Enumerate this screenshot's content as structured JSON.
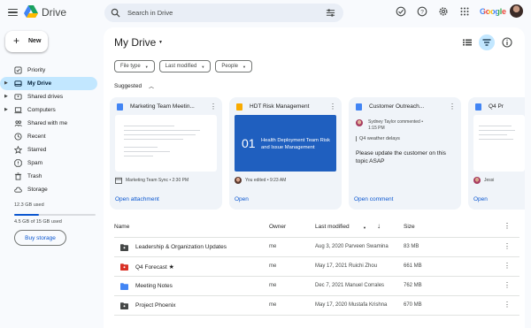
{
  "app": {
    "title": "Drive"
  },
  "search": {
    "placeholder": "Search in Drive"
  },
  "header": {
    "brand": "Google"
  },
  "sidebar": {
    "new_label": "New",
    "items": [
      {
        "label": "Priority",
        "icon": "priority-icon"
      },
      {
        "label": "My Drive",
        "icon": "my-drive-icon",
        "active": true
      },
      {
        "label": "Shared drives",
        "icon": "shared-drives-icon"
      },
      {
        "label": "Computers",
        "icon": "computer-icon"
      },
      {
        "label": "Shared with me",
        "icon": "shared-with-me-icon"
      },
      {
        "label": "Recent",
        "icon": "clock-icon"
      },
      {
        "label": "Starred",
        "icon": "star-icon"
      },
      {
        "label": "Spam",
        "icon": "spam-icon"
      },
      {
        "label": "Trash",
        "icon": "trash-icon"
      },
      {
        "label": "Storage",
        "icon": "cloud-icon"
      }
    ],
    "storage_used": "12.3 GB used",
    "storage_detail": "4.5 GB of 15 GB used",
    "storage_fraction": 0.3,
    "buy_storage": "Buy storage"
  },
  "main": {
    "title": "My Drive",
    "filters": [
      "File type",
      "Last modified",
      "People"
    ],
    "suggested_label": "Suggested"
  },
  "cards": [
    {
      "title": "Marketing Team Meetin...",
      "meta": "Marketing Team Sync • 2:30 PM",
      "action": "Open attachment",
      "icon_color": "#4285f4"
    },
    {
      "title": "HDT Risk Management",
      "slide_num": "01",
      "slide_text": "Health Deployment Team Risk and Issue Management",
      "meta": "You edited • 9:23 AM",
      "action": "Open",
      "icon_color": "#f9ab00"
    },
    {
      "title": "Customer Outreach...",
      "commenter": "Sydney Taylor commented •",
      "comment_time": "1:15 PM",
      "quote": "Q4 weather delays",
      "comment": "Please update the customer on this topic ASAP",
      "action": "Open comment",
      "icon_color": "#4285f4"
    },
    {
      "title": "Q4 Pr",
      "meta": "Jessi",
      "action": "Open",
      "icon_color": "#4285f4"
    }
  ],
  "table": {
    "headers": {
      "name": "Name",
      "owner": "Owner",
      "modified": "Last modified",
      "size": "Size"
    },
    "rows": [
      {
        "name": "Leadership & Organization Updates",
        "owner": "me",
        "modified": "Aug 3, 2020 Parveen Swamina",
        "size": "83 MB",
        "type": "shared-folder"
      },
      {
        "name": "Q4 Forecast",
        "owner": "me",
        "modified": "May 17, 2021 Ruichi Zhou",
        "size": "661 MB",
        "type": "red-shared-folder",
        "starred": true
      },
      {
        "name": "Meeting Notes",
        "owner": "me",
        "modified": "Dec 7, 2021 Manuel Corrales",
        "size": "762 MB",
        "type": "blue-folder"
      },
      {
        "name": "Project Phoenix",
        "owner": "me",
        "modified": "May 17, 2020 Mustafa Krishna",
        "size": "670 MB",
        "type": "shared-folder"
      }
    ]
  },
  "colors": {
    "accent": "#0b57d0",
    "active_bg": "#c2e7ff",
    "background": "#f8fafd"
  }
}
